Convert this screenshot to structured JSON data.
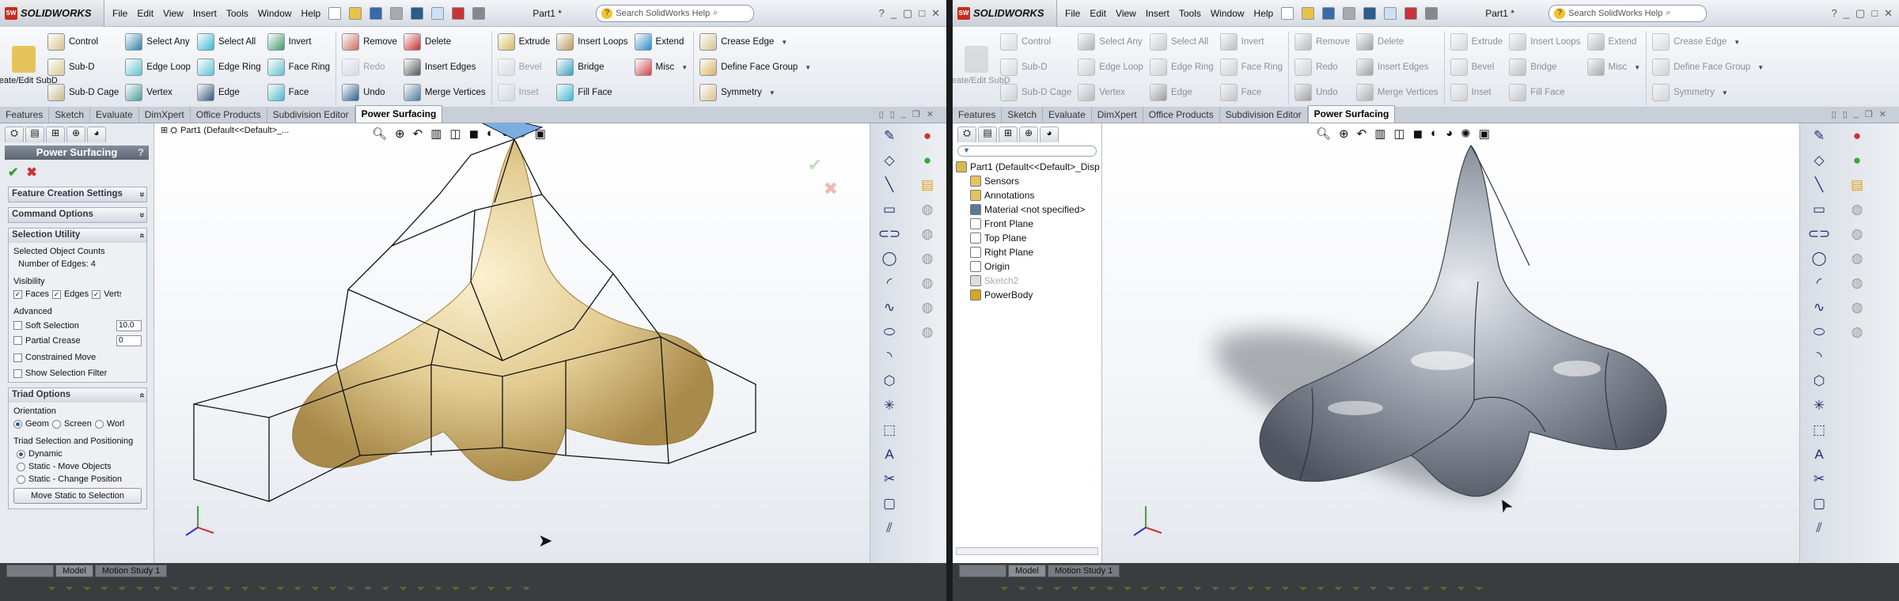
{
  "app": {
    "brand": "SOLIDWORKS",
    "doc_title": "Part1 *",
    "search_placeholder": "Search SolidWorks Help"
  },
  "menu": [
    "File",
    "Edit",
    "View",
    "Insert",
    "Tools",
    "Window",
    "Help"
  ],
  "ribbon": {
    "big": {
      "label": "Create/Edit SubD",
      "color": "#e6c35a"
    },
    "columns": [
      [
        {
          "label": "Control",
          "color": "#d8c08a"
        },
        {
          "label": "Sub-D",
          "color": "#d9c890"
        },
        {
          "label": "Sub-D Cage",
          "color": "#c9b888"
        }
      ],
      [
        {
          "label": "Select Any",
          "color": "#2c7fa8"
        },
        {
          "label": "Edge Loop",
          "color": "#5fc3d0"
        },
        {
          "label": "Vertex",
          "color": "#4a9a9a"
        }
      ],
      [
        {
          "label": "Select All",
          "color": "#38b8d0"
        },
        {
          "label": "Edge Ring",
          "color": "#5fc3d0"
        },
        {
          "label": "Edge",
          "color": "#335577"
        }
      ],
      [
        {
          "label": "Invert",
          "color": "#3b9c6b"
        },
        {
          "label": "Face Ring",
          "color": "#5fc3d0"
        },
        {
          "label": "Face",
          "color": "#48b8cc"
        }
      ],
      "sep",
      [
        {
          "label": "Remove",
          "color": "#d06a5a"
        },
        {
          "label": "Redo",
          "color": "#b0b6bc",
          "disabled": true
        },
        {
          "label": "Undo",
          "color": "#2a5d8a"
        }
      ],
      [
        {
          "label": "Delete",
          "color": "#cc2a2a"
        },
        {
          "label": "Insert Edges",
          "color": "#555"
        },
        {
          "label": "Merge Vertices",
          "color": "#4a7a9a"
        }
      ],
      "sep",
      [
        {
          "label": "Extrude",
          "color": "#d6b85e"
        },
        {
          "label": "Bevel",
          "color": "#bbb",
          "disabled": true
        },
        {
          "label": "Inset",
          "color": "#bbb",
          "disabled": true
        }
      ],
      [
        {
          "label": "Insert Loops",
          "color": "#b99a5a"
        },
        {
          "label": "Bridge",
          "color": "#3aa0c0"
        },
        {
          "label": "Fill Face",
          "color": "#38b8d0"
        }
      ],
      [
        {
          "label": "Extend",
          "color": "#2c88c8"
        },
        {
          "label": "Misc",
          "color": "#c44",
          "caret": true
        }
      ],
      "sep",
      [
        {
          "label": "Crease Edge",
          "color": "#d8c08a",
          "caret": true
        },
        {
          "label": "Define Face Group",
          "color": "#d8b060",
          "caret": true
        },
        {
          "label": "Symmetry",
          "color": "#d8c08a",
          "caret": true
        }
      ]
    ]
  },
  "tabs": [
    "Features",
    "Sketch",
    "Evaluate",
    "DimXpert",
    "Office Products",
    "Subdivision Editor",
    "Power Surfacing"
  ],
  "active_tab": "Power Surfacing",
  "left": {
    "breadcrumb": "Part1  (Default<<Default>_...",
    "pm": {
      "title": "Power Surfacing",
      "help": "?",
      "groups": {
        "feature_creation": "Feature Creation Settings",
        "command_options": "Command Options",
        "selection_utility": "Selection Utility",
        "triad_options": "Triad Options"
      },
      "selected_counts_label": "Selected Object Counts",
      "edges_count": "Number of Edges: 4",
      "visibility": "Visibility",
      "vis": [
        {
          "label": "Faces",
          "checked": true
        },
        {
          "label": "Edges",
          "checked": true
        },
        {
          "label": "Verts",
          "checked": true
        }
      ],
      "advanced": "Advanced",
      "soft_selection": {
        "label": "Soft Selection",
        "value": "10.0"
      },
      "partial_crease": {
        "label": "Partial Crease",
        "value": "0"
      },
      "constrained_move": "Constrained Move",
      "show_selection_filter": "Show Selection Filter",
      "orientation": "Orientation",
      "orient_opts": [
        "Geom",
        "Screen",
        "World"
      ],
      "orient_selected": "Geom",
      "triad_sel": "Triad Selection and Positioning",
      "triad_opts": [
        "Dynamic",
        "Static - Move Objects",
        "Static - Change Position"
      ],
      "triad_selected": "Dynamic",
      "move_static_btn": "Move Static to Selection"
    }
  },
  "right": {
    "tree": [
      {
        "label": "Part1  (Default<<Default>_Disp",
        "icon": "part-icon",
        "color": "#d9b84a",
        "root": true
      },
      {
        "label": "Sensors",
        "icon": "sensors-icon",
        "color": "#e6c35a"
      },
      {
        "label": "Annotations",
        "icon": "annotations-icon",
        "color": "#e6c35a"
      },
      {
        "label": "Material <not specified>",
        "icon": "material-icon",
        "color": "#5a7a9a"
      },
      {
        "label": "Front Plane",
        "icon": "plane-icon",
        "color": "#fff"
      },
      {
        "label": "Top Plane",
        "icon": "plane-icon",
        "color": "#fff"
      },
      {
        "label": "Right Plane",
        "icon": "plane-icon",
        "color": "#fff"
      },
      {
        "label": "Origin",
        "icon": "origin-icon",
        "color": "#fff"
      },
      {
        "label": "Sketch2",
        "icon": "sketch-icon",
        "color": "#ddd",
        "muted": true
      },
      {
        "label": "PowerBody",
        "icon": "body-icon",
        "color": "#d9a520"
      }
    ]
  },
  "bottom_tabs": [
    "Model",
    "Motion Study 1"
  ],
  "colors": {
    "part_fill": "#e3cc92",
    "part_grey": "#9aa0ab",
    "accent": "#2a5d8a"
  }
}
